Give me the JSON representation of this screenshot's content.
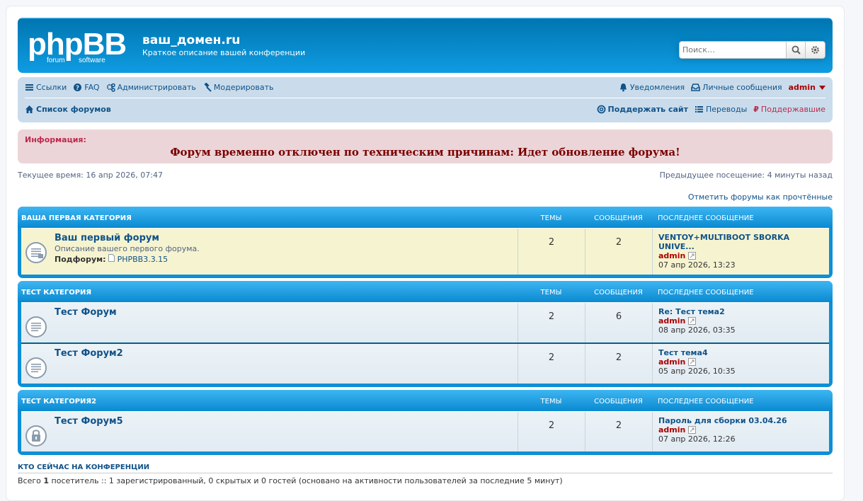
{
  "header": {
    "logo_text": "phpBB",
    "logo_sub_left": "forum",
    "logo_sub_right": "software",
    "site_title": "ваш_домен.ru",
    "site_desc": "Краткое описание вашей конференции",
    "search_placeholder": "Поиск…"
  },
  "nav": {
    "links": "Ссылки",
    "faq": "FAQ",
    "admin": "Администрировать",
    "moderate": "Модерировать",
    "notifications": "Уведомления",
    "pm": "Личные сообщения",
    "username": "admin",
    "forum_list": "Список форумов",
    "support": "Поддержать сайт",
    "translations": "Переводы",
    "supporters": "Поддержавшие"
  },
  "info": {
    "title": "Информация:",
    "message": "Форум временно отключен по техническим причинам: Идет обновление форума!"
  },
  "timebar": {
    "current": "Текущее время: 16 апр 2026, 07:47",
    "previous": "Предыдущее посещение: 4 минуты назад",
    "mark_read": "Отметить форумы как прочтённые"
  },
  "columns": {
    "topics": "Темы",
    "posts": "Сообщения",
    "last_post": "Последнее сообщение"
  },
  "categories": [
    {
      "name": "Ваша первая категория",
      "forums": [
        {
          "title": "Ваш первый форум",
          "desc": "Описание вашего первого форума.",
          "sub_label": "Подфорум:",
          "sub_name": "PHPBB3.3.15",
          "topics": "2",
          "posts": "2",
          "last_title": "VENTOY+MULTIBOOT SBORKA UNIVE...",
          "last_author": "admin",
          "last_date": "07 апр 2026, 13:23"
        }
      ]
    },
    {
      "name": "Тест категория",
      "forums": [
        {
          "title": "Тест Форум",
          "topics": "2",
          "posts": "6",
          "last_title": "Re: Тест тема2",
          "last_author": "admin",
          "last_date": "08 апр 2026, 03:35"
        },
        {
          "title": "Тест Форум2",
          "topics": "2",
          "posts": "2",
          "last_title": "Тест тема4",
          "last_author": "admin",
          "last_date": "05 апр 2026, 10:35"
        }
      ]
    },
    {
      "name": "Тест категория2",
      "forums": [
        {
          "title": "Тест Форум5",
          "topics": "2",
          "posts": "2",
          "last_title": "Пароль для сборки 03.04.26",
          "last_author": "admin",
          "last_date": "07 апр 2026, 12:26"
        }
      ]
    }
  ],
  "online": {
    "title": "Кто сейчас на конференции",
    "text_prefix": "Всего ",
    "count": "1",
    "text_suffix": " посетитель :: 1 зарегистрированный, 0 скрытых и 0 гостей (основано на активности пользователей за последние 5 минут)"
  }
}
